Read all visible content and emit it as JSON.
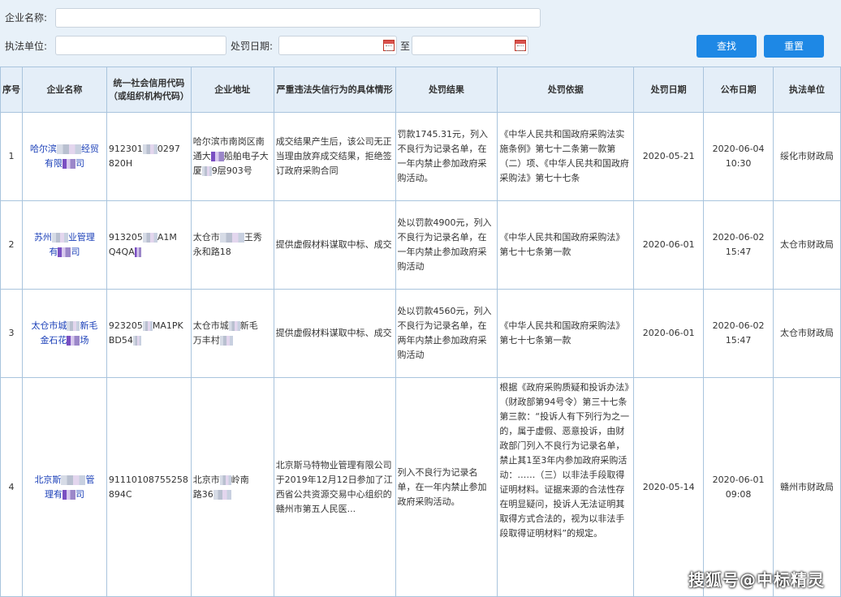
{
  "search": {
    "company_label": "企业名称:",
    "unit_label": "执法单位:",
    "date_label": "处罚日期:",
    "to_label": "至",
    "search_btn": "查找",
    "reset_btn": "重置"
  },
  "table": {
    "headers": {
      "no": "序号",
      "name": "企业名称",
      "code": "统一社会信用代码（或组织机构代码）",
      "addr": "企业地址",
      "case": "严重违法失信行为的具体情形",
      "result": "处罚结果",
      "basis": "处罚依据",
      "pdate": "处罚日期",
      "pubdate": "公布日期",
      "unit": "执法单位"
    },
    "rows": [
      {
        "no": "1",
        "name_a": "哈尔滨",
        "name_b": "经贸",
        "name_c": "有限",
        "name_d": "司",
        "code_a": "912301",
        "code_b": "0297",
        "code_c": "820H",
        "addr_a": "哈尔滨市南岗区南通大",
        "addr_b": "船舶电子大厦",
        "addr_c": "9层903号",
        "case": "成交结果产生后，该公司无正当理由放弃成交结果，拒绝签订政府采购合同",
        "result": "罚款1745.31元，列入不良行为记录名单，在一年内禁止参加政府采购活动。",
        "basis": "《中华人民共和国政府采购法实施条例》第七十二条第一款第（二）项、《中华人民共和国政府采购法》第七十七条",
        "pdate": "2020-05-21",
        "pubdate_a": "2020-06-04",
        "pubdate_b": "10:30",
        "unit": "绥化市财政局"
      },
      {
        "no": "2",
        "name_a": "苏州",
        "name_b": "业管理",
        "name_c": "有",
        "name_d": "司",
        "code_a": "913205",
        "code_b": "A1M",
        "code_c": "Q4QA",
        "addr_a": "太仓市",
        "addr_b": "王秀",
        "addr_c": "永和路18",
        "case": "提供虚假材料谋取中标、成交",
        "result": "处以罚款4900元，列入不良行为记录名单，在一年内禁止参加政府采购活动",
        "basis": "《中华人民共和国政府采购法》第七十七条第一款",
        "pdate": "2020-06-01",
        "pubdate_a": "2020-06-02",
        "pubdate_b": "15:47",
        "unit": "太仓市财政局"
      },
      {
        "no": "3",
        "name_a": "太仓市城",
        "name_b": "新毛",
        "name_c": "金石花",
        "name_d": "场",
        "code_a": "923205",
        "code_b": "MA1PK",
        "code_c": "BD54",
        "addr_a": "太仓市城",
        "addr_b": "新毛",
        "addr_c": "万丰村",
        "case": "提供虚假材料谋取中标、成交",
        "result": "处以罚款4560元，列入不良行为记录名单，在两年内禁止参加政府采购活动",
        "basis": "《中华人民共和国政府采购法》第七十七条第一款",
        "pdate": "2020-06-01",
        "pubdate_a": "2020-06-02",
        "pubdate_b": "15:47",
        "unit": "太仓市财政局"
      },
      {
        "no": "4",
        "name_a": "北京斯",
        "name_b": "管",
        "name_c": "理有",
        "name_d": "司",
        "code_a": "91110108755258",
        "code_b": "",
        "code_c": "894C",
        "addr_a": "北京市",
        "addr_b": "岭南",
        "addr_c": "路36",
        "case": "北京斯马特物业管理有限公司于2019年12月12日参加了江西省公共资源交易中心组织的赣州市第五人民医...",
        "result": "列入不良行为记录名单，在一年内禁止参加政府采购活动。",
        "basis": "根据《政府采购质疑和投诉办法》（财政部第94号令）第三十七条第三款：“投诉人有下列行为之一的，属于虚假、恶意投诉，由财政部门列入不良行为记录名单，禁止其1至3年内参加政府采购活动：……（三）以非法手段取得证明材料。证据来源的合法性存在明显疑问，投诉人无法证明其取得方式合法的，视为以非法手段取得证明材料”的规定。",
        "pdate": "2020-05-14",
        "pubdate_a": "2020-06-01",
        "pubdate_b": "09:08",
        "unit": "赣州市财政局"
      }
    ]
  },
  "watermark": "搜狐号@中标精灵"
}
